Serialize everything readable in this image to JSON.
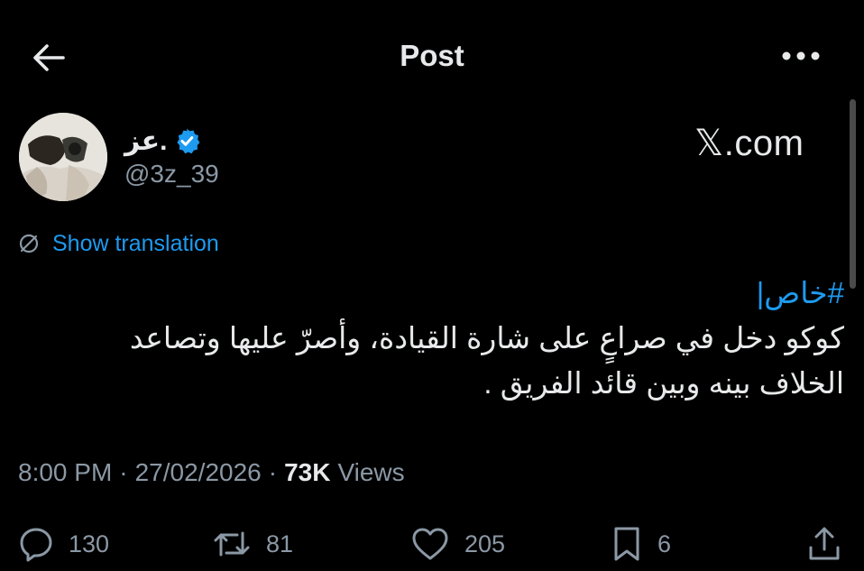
{
  "header": {
    "title": "Post"
  },
  "author": {
    "name": "عز.",
    "handle": "@3z_39",
    "verified": true
  },
  "watermark": "𝕏.com",
  "translation": {
    "label": "Show translation"
  },
  "post": {
    "hashtag": "#خاص|",
    "text": "كوكو دخل في صراعٍ على شارة القيادة، وأصرّ عليها وتصاعد الخلاف بينه وبين قائد الفريق ."
  },
  "meta": {
    "time": "8:00 PM",
    "separator": "·",
    "date": "27/02/2026",
    "views_count": "73K",
    "views_label": "Views"
  },
  "actions": {
    "replies": "130",
    "reposts": "81",
    "likes": "205",
    "bookmarks": "6"
  },
  "colors": {
    "background": "#000000",
    "text": "#e7e9ea",
    "muted": "#8b98a5",
    "accent": "#1d9bf0"
  },
  "icons": [
    "back-arrow-icon",
    "more-icon",
    "verified-icon",
    "translate-icon",
    "reply-icon",
    "repost-icon",
    "like-icon",
    "bookmark-icon",
    "share-icon"
  ]
}
